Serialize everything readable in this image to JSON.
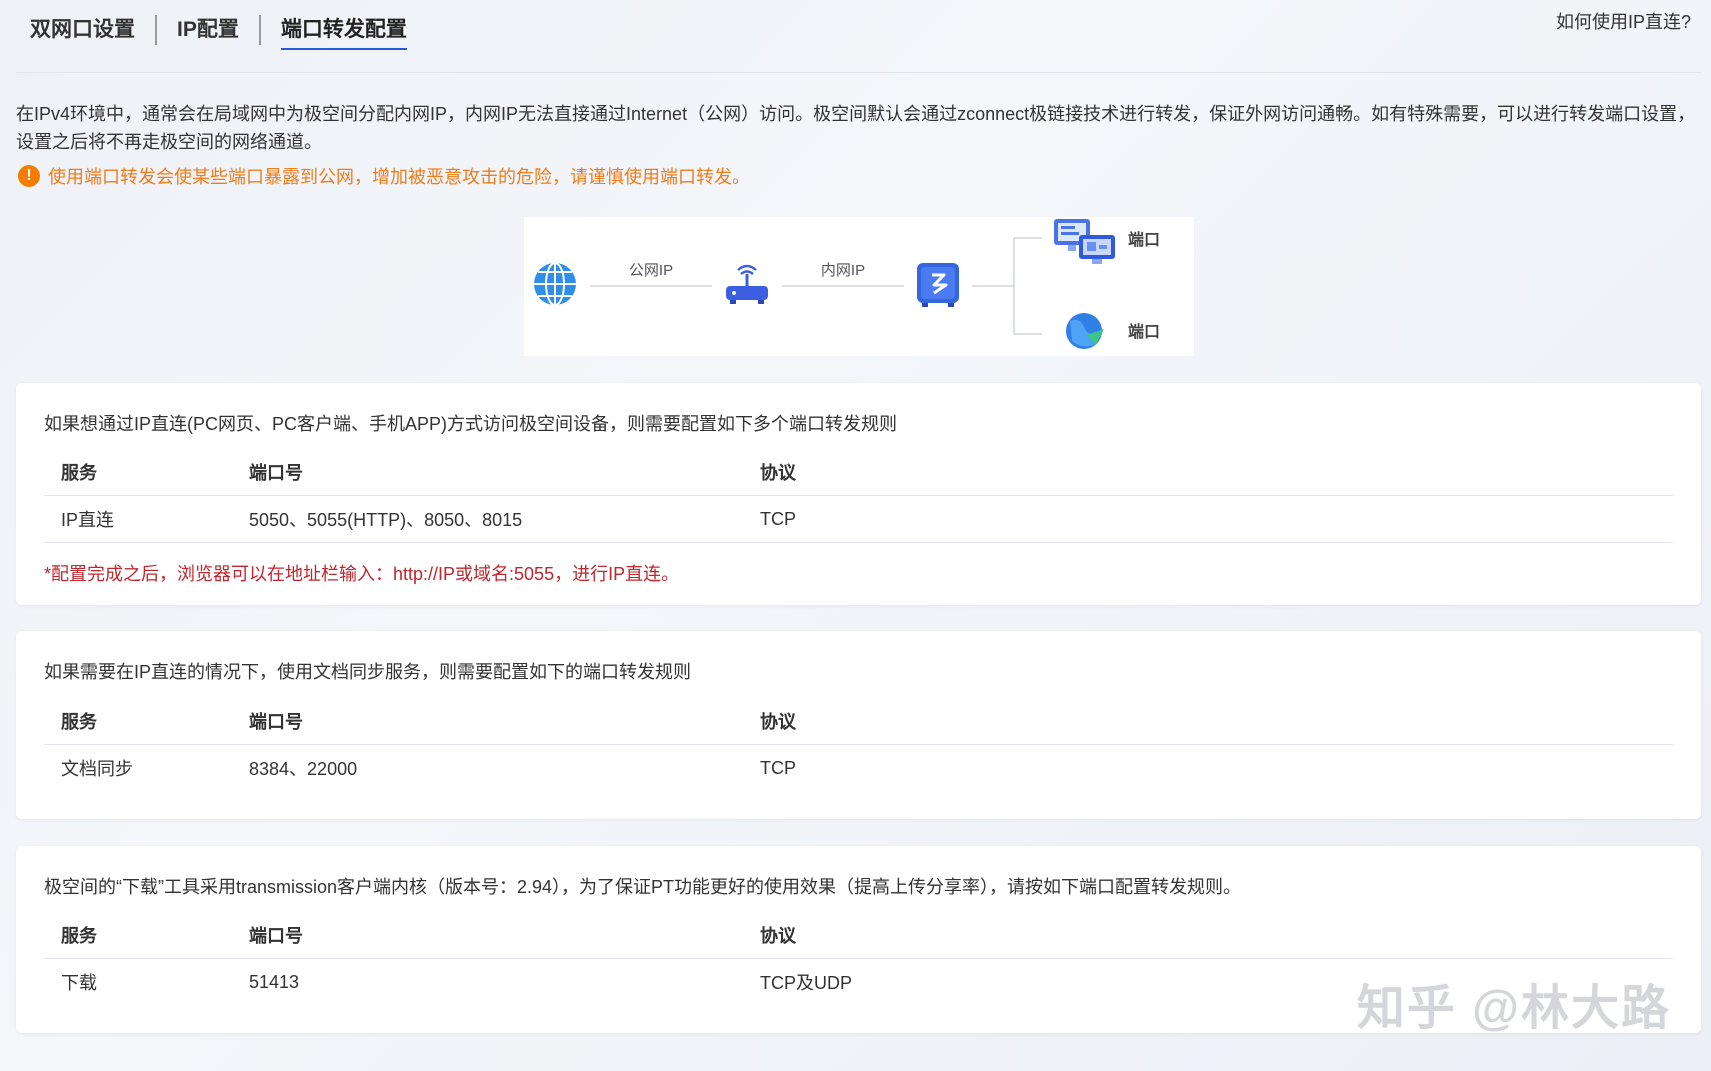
{
  "tabs": [
    {
      "label": "双网口设置"
    },
    {
      "label": "IP配置"
    },
    {
      "label": "端口转发配置"
    }
  ],
  "help_link": "如何使用IP直连?",
  "intro": "在IPv4环境中，通常会在局域网中为极空间分配内网IP，内网IP无法直接通过Internet（公网）访问。极空间默认会通过zconnect极链接技术进行转发，保证外网访问通畅。如有特殊需要，可以进行转发端口设置，设置之后将不再走极空间的网络通道。",
  "warning": "使用端口转发会使某些端口暴露到公网，增加被恶意攻击的危险，请谨慎使用端口转发。",
  "diagram": {
    "public_ip_label": "公网IP",
    "lan_ip_label": "内网IP",
    "port_top_label": "端口",
    "port_bottom_label": "端口",
    "icons": [
      "globe-icon",
      "router-icon",
      "nas-device-icon",
      "pc-clients-icon",
      "browser-globe-icon"
    ]
  },
  "columns": {
    "service": "服务",
    "port": "端口号",
    "protocol": "协议"
  },
  "cards": [
    {
      "desc": "如果想通过IP直连(PC网页、PC客户端、手机APP)方式访问极空间设备，则需要配置如下多个端口转发规则",
      "rows": [
        {
          "service": "IP直连",
          "port": "5050、5055(HTTP)、8050、8015",
          "protocol": "TCP"
        }
      ],
      "note": "*配置完成之后，浏览器可以在地址栏输入：http://IP或域名:5055，进行IP直连。"
    },
    {
      "desc": "如果需要在IP直连的情况下，使用文档同步服务，则需要配置如下的端口转发规则",
      "rows": [
        {
          "service": "文档同步",
          "port": "8384、22000",
          "protocol": "TCP"
        }
      ]
    },
    {
      "desc": "极空间的“下载”工具采用transmission客户端内核（版本号：2.94），为了保证PT功能更好的使用效果（提高上传分享率），请按如下端口配置转发规则。",
      "rows": [
        {
          "service": "下载",
          "port": "51413",
          "protocol": "TCP及UDP"
        }
      ]
    }
  ],
  "watermark": "知乎 @林大路",
  "colors": {
    "accent": "#2a5bd7",
    "warning": "#f07c1a",
    "note": "#c0262d"
  }
}
